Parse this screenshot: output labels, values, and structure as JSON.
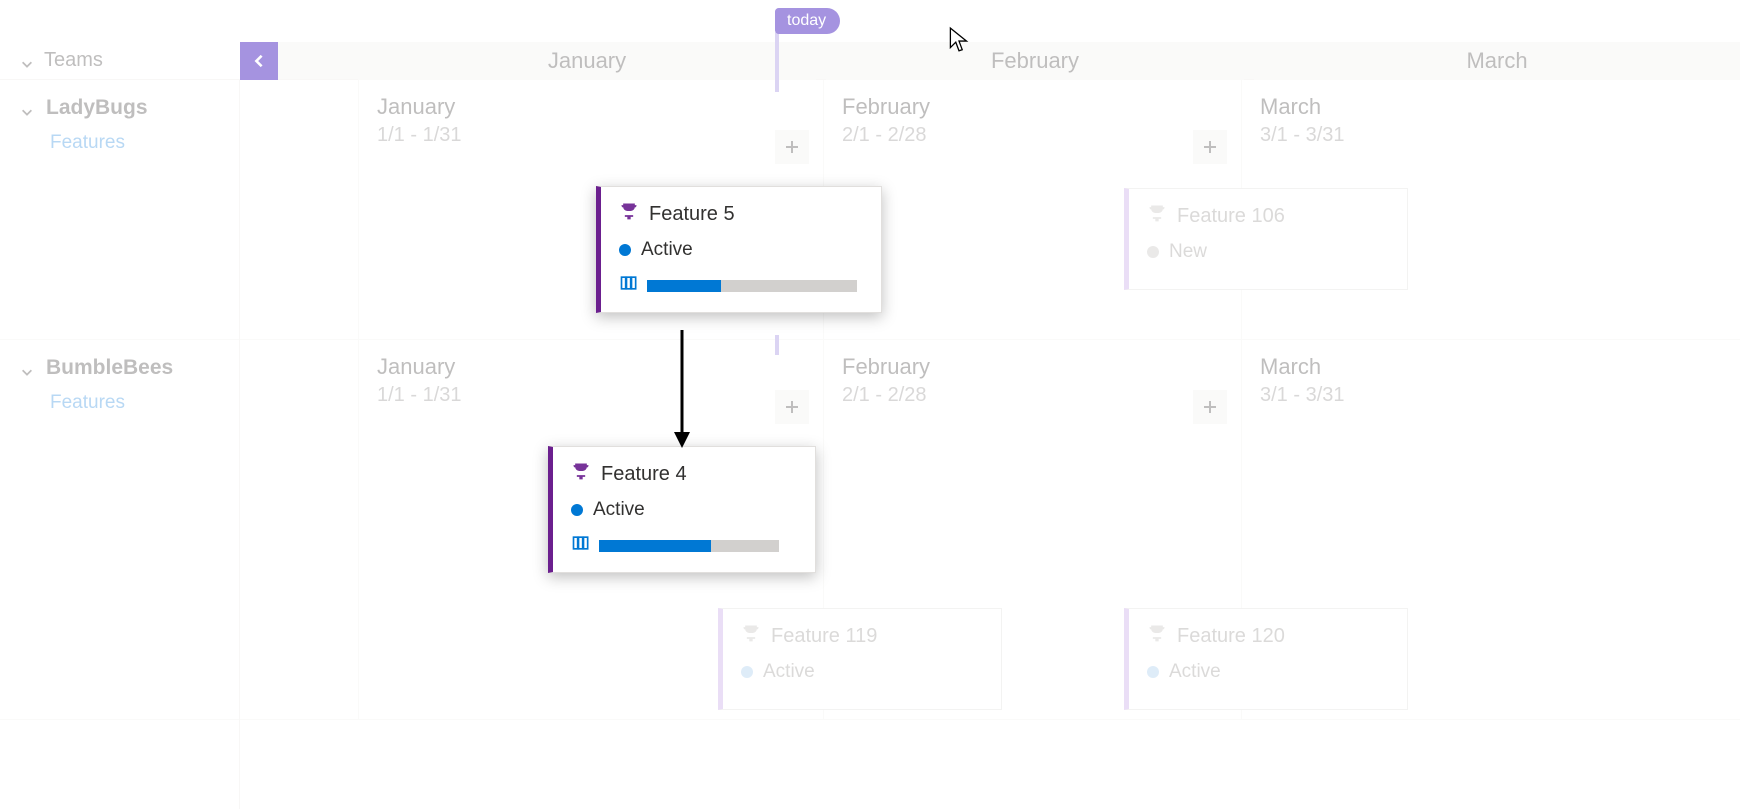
{
  "today_label": "today",
  "header": {
    "teams_label": "Teams"
  },
  "timeline_months": {
    "jan": "January",
    "feb": "February",
    "mar": "March"
  },
  "month_ranges": {
    "jan": "1/1 - 1/31",
    "feb": "2/1 - 2/28",
    "mar": "3/1 - 3/31"
  },
  "teams": {
    "ladybugs": {
      "name": "LadyBugs",
      "sub": "Features"
    },
    "bumblebees": {
      "name": "BumbleBees",
      "sub": "Features"
    }
  },
  "status_labels": {
    "active": "Active",
    "new": "New"
  },
  "cards": {
    "feature5": {
      "title": "Feature 5",
      "status": "Active",
      "progress": 0.35
    },
    "feature106": {
      "title": "Feature 106",
      "status": "New"
    },
    "feature4": {
      "title": "Feature 4",
      "status": "Active",
      "progress": 0.62
    },
    "feature119": {
      "title": "Feature 119",
      "status": "Active"
    },
    "feature120": {
      "title": "Feature 120",
      "status": "Active"
    }
  }
}
